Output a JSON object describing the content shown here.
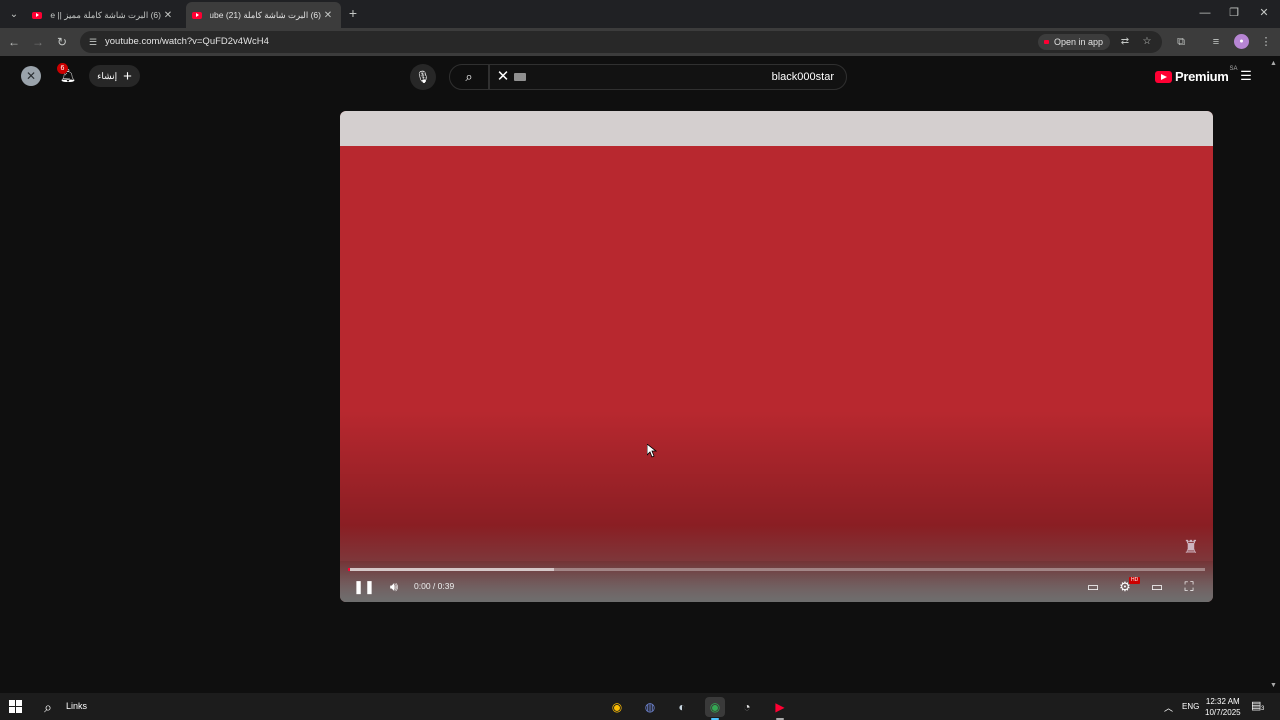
{
  "browser": {
    "tabs": [
      {
        "title": "(6) البرت شاشة كاملة مميز || ube"
      },
      {
        "title": "(6) البرت شاشة كاملة (21) Tube"
      }
    ],
    "url": "youtube.com/watch?v=QuFD2v4WcH4",
    "open_in_app": "Open in app"
  },
  "youtube": {
    "notifications_count": "6",
    "create_label": "إنشاء",
    "search_query": "black000star",
    "logo_text": "Premium",
    "country_code": "SA"
  },
  "player": {
    "time": "0:00 / 0:39",
    "buffered_fraction": 0.24,
    "played_fraction": 0.0,
    "state": "playing",
    "hd_badge": "HD",
    "colors": {
      "video_background": "#b8282f",
      "top_band": "#d4cfcf",
      "progress": "#ff0033"
    }
  },
  "taskbar": {
    "links_label": "Links",
    "apps": [
      {
        "icon": "chrome-icon"
      },
      {
        "icon": "discord-icon"
      },
      {
        "icon": "steam-icon"
      },
      {
        "icon": "chrome-profile-icon"
      },
      {
        "icon": "clock-app-icon"
      },
      {
        "icon": "youtube-app-icon"
      }
    ],
    "language": "ENG",
    "time": "12:32 AM",
    "date": "10/7/2025",
    "notification_count": "3"
  }
}
